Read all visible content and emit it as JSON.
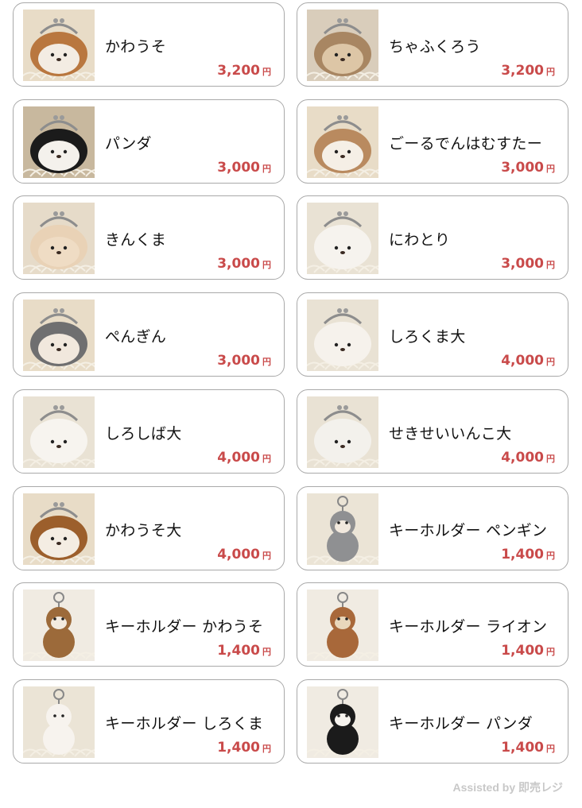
{
  "products": [
    {
      "name": "かわうそ",
      "price": "3,200",
      "currency": "円",
      "icon": "otter-purse-image",
      "fur": "#b9773f",
      "face": "#f3ece3",
      "bg": "#e8dcc7"
    },
    {
      "name": "ちゃふくろう",
      "price": "3,200",
      "currency": "円",
      "icon": "owl-purse-image",
      "fur": "#a88662",
      "face": "#ddc6a6",
      "bg": "#d9cdbb"
    },
    {
      "name": "パンダ",
      "price": "3,000",
      "currency": "円",
      "icon": "panda-purse-image",
      "fur": "#1b1b1b",
      "face": "#f4f1ec",
      "bg": "#c8b89e"
    },
    {
      "name": "ごーるでんはむすたー",
      "price": "3,000",
      "currency": "円",
      "icon": "hamster-purse-image",
      "fur": "#b98a5f",
      "face": "#f5efe6",
      "bg": "#e8dcc7"
    },
    {
      "name": "きんくま",
      "price": "3,000",
      "currency": "円",
      "icon": "kinkuma-purse-image",
      "fur": "#e9d2b6",
      "face": "#efdcc4",
      "bg": "#e6dbc9"
    },
    {
      "name": "にわとり",
      "price": "3,000",
      "currency": "円",
      "icon": "chicken-purse-image",
      "fur": "#f6f3ee",
      "face": "#f6f3ee",
      "bg": "#e9e2d4"
    },
    {
      "name": "ぺんぎん",
      "price": "3,000",
      "currency": "円",
      "icon": "penguin-purse-image",
      "fur": "#6f6f70",
      "face": "#f1e8dd",
      "bg": "#e8dcc7"
    },
    {
      "name": "しろくま大",
      "price": "4,000",
      "currency": "円",
      "icon": "polar-bear-purse-image",
      "fur": "#f6f2ec",
      "face": "#f6f2ec",
      "bg": "#e9e2d4"
    },
    {
      "name": "しろしば大",
      "price": "4,000",
      "currency": "円",
      "icon": "white-shiba-purse-image",
      "fur": "#f7f4ef",
      "face": "#f7f4ef",
      "bg": "#e9e2d4"
    },
    {
      "name": "せきせいいんこ大",
      "price": "4,000",
      "currency": "円",
      "icon": "budgie-purse-image",
      "fur": "#f3f1ec",
      "face": "#f3f1ec",
      "bg": "#e9e2d4"
    },
    {
      "name": "かわうそ大",
      "price": "4,000",
      "currency": "円",
      "icon": "large-otter-purse-image",
      "fur": "#9c5f2c",
      "face": "#f4ede3",
      "bg": "#e8dcc7"
    },
    {
      "name": "キーホルダー ペンギン",
      "price": "1,400",
      "currency": "円",
      "icon": "penguin-keychain-image",
      "fur": "#8f9092",
      "face": "#f1e8dd",
      "bg": "#ebe4d6"
    },
    {
      "name": "キーホルダー かわうそ",
      "price": "1,400",
      "currency": "円",
      "icon": "otter-keychain-image",
      "fur": "#9c6a3a",
      "face": "#f3ebe0",
      "bg": "#f0ebe2"
    },
    {
      "name": "キーホルダー ライオン",
      "price": "1,400",
      "currency": "円",
      "icon": "lion-keychain-image",
      "fur": "#a8683a",
      "face": "#e9d7bb",
      "bg": "#f0ebe2"
    },
    {
      "name": "キーホルダー しろくま",
      "price": "1,400",
      "currency": "円",
      "icon": "polar-bear-keychain-image",
      "fur": "#f7f3ee",
      "face": "#f7f3ee",
      "bg": "#ebe4d6"
    },
    {
      "name": "キーホルダー パンダ",
      "price": "1,400",
      "currency": "円",
      "icon": "panda-keychain-image",
      "fur": "#1b1b1b",
      "face": "#f6f3ee",
      "bg": "#f0ebe2"
    }
  ],
  "footer": {
    "text": "Assisted by 即売レジ"
  },
  "colors": {
    "price": "#c94a4a",
    "card_border": "#a9a9a9",
    "footer_text": "#c8c8c8"
  }
}
